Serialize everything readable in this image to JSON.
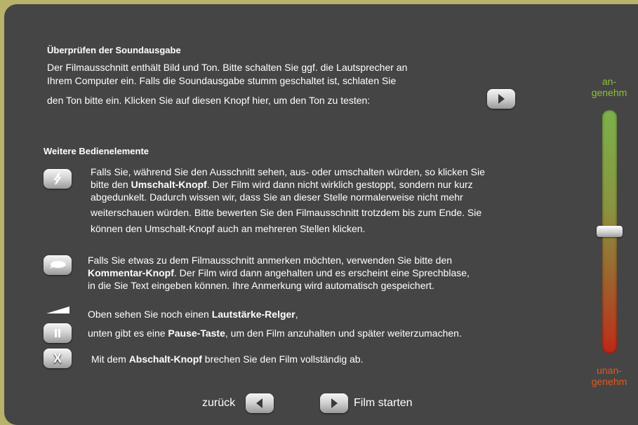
{
  "sound_check": {
    "title": "Überprüfen der Soundausgabe",
    "lines": [
      "Der Filmausschnitt enthält Bild und Ton. Bitte schalten Sie ggf. die Lautsprecher an",
      "Ihrem Computer ein. Falls die Soundausgabe stumm geschaltet ist, schlaten Sie",
      "den Ton bitte ein. Klicken Sie auf diesen Knopf hier, um den Ton zu testen:"
    ]
  },
  "controls": {
    "title": "Weitere Bedienelemente",
    "switch": {
      "line1": "Falls Sie, während Sie den Ausschnitt sehen, aus- oder umschalten würden, so klicken Sie",
      "line2_pre": "bitte den ",
      "line2_bold": "Umschalt-Knopf",
      "line2_post": ". Der Film wird dann nicht wirklich gestoppt, sondern nur kurz",
      "line3": "abgedunkelt. Dadurch wissen wir, dass Sie an dieser Stelle normalerweise nicht mehr",
      "line4": "weiterschauen würden. Bitte bewerten Sie den Filmausschnitt trotzdem bis zum Ende. Sie",
      "line5": "können den Umschalt-Knopf auch an mehreren Stellen klicken."
    },
    "comment": {
      "line1": "Falls Sie etwas zu dem Filmausschnitt anmerken möchten, verwenden Sie bitte den",
      "line2_bold": "Kommentar-Knopf",
      "line2_post": ". Der Film wird dann angehalten und es erscheint eine Sprechblase,",
      "line3": "in die Sie Text eingeben können. Ihre Anmerkung wird automatisch gespeichert."
    },
    "volume": {
      "pre": "Oben sehen Sie noch einen ",
      "bold": "Lautstärke-Relger",
      "post": ","
    },
    "pause": {
      "pre": "unten gibt es eine ",
      "bold": "Pause-Taste",
      "post": ", um den Film anzuhalten und später weiterzumachen."
    },
    "abort": {
      "pre": "Mit dem ",
      "bold": "Abschalt-Knopf",
      "post": " brechen Sie den Film vollständig ab.",
      "button_label": "X"
    }
  },
  "rating_scale": {
    "top_label": "an-\ngenehm",
    "bottom_label": "unan-\ngenehm",
    "top_color": "#8fbf3a",
    "bottom_color": "#e05a1a",
    "value": 0.5
  },
  "nav": {
    "back_label": "zurück",
    "start_label": "Film starten"
  }
}
